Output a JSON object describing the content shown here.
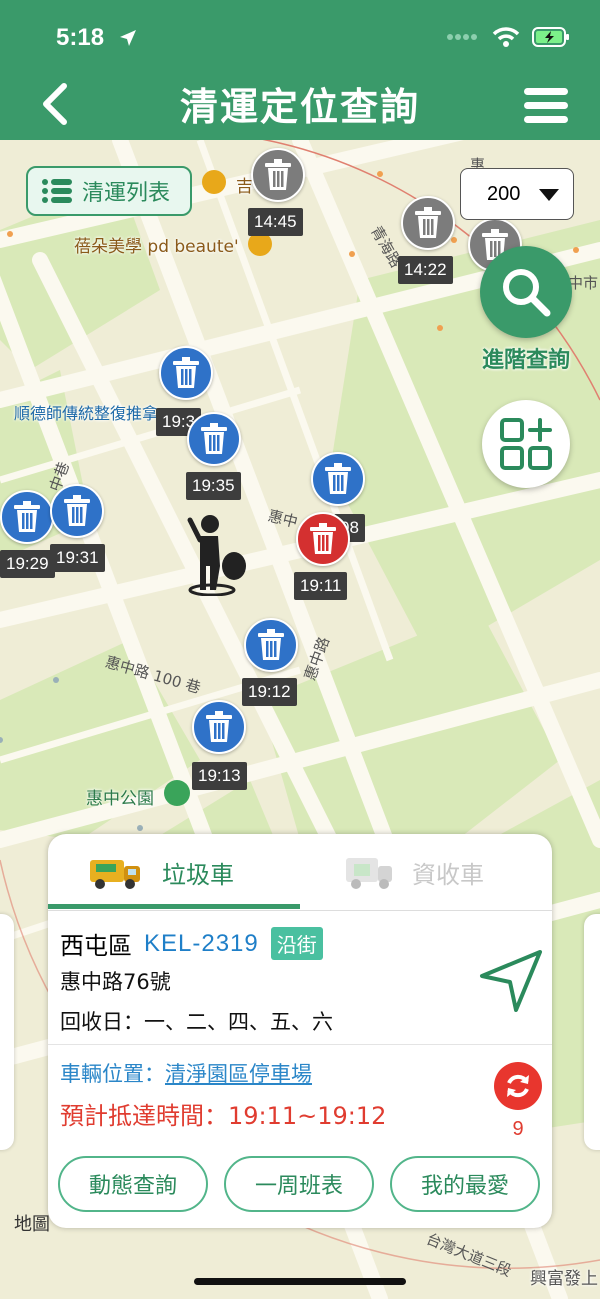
{
  "status_bar": {
    "time": "5:18"
  },
  "header": {
    "title": "清運定位查詢"
  },
  "map": {
    "list_button_label": "清運列表",
    "radius_select": {
      "value": "200"
    },
    "advanced_search_label": "進階查詢",
    "poi": {
      "ji": "吉",
      "beauty": "蓓朵美學 pd beaute'",
      "massage": "順德師傳統整復推拿",
      "park": "惠中公園",
      "rear_right": "興富發上"
    },
    "streets": {
      "road100": "惠中路 100 巷",
      "road": "惠中路",
      "hui": "惠中",
      "qinghai": "青海路",
      "zhongshi": "中市",
      "taiwan": "台灣大道三段",
      "zhong": "中巷",
      "hui_top": "惠"
    },
    "markers": [
      {
        "time": "14:45",
        "color": "gray"
      },
      {
        "time": "14:22",
        "color": "gray"
      },
      {
        "time": "19:3",
        "color": "blue"
      },
      {
        "time": "19:35",
        "color": "blue"
      },
      {
        "time": "08",
        "color": "blue"
      },
      {
        "time": "19:29",
        "color": "blue"
      },
      {
        "time": "19:31",
        "color": "blue"
      },
      {
        "time": "19:11",
        "color": "red"
      },
      {
        "time": "19:12",
        "color": "blue"
      },
      {
        "time": "19:13",
        "color": "blue"
      }
    ],
    "legal": "地圖"
  },
  "card": {
    "tabs": [
      {
        "label": "垃圾車"
      },
      {
        "label": "資收車"
      }
    ],
    "district": "西屯區",
    "plate": "KEL-2319",
    "badge": "沿街",
    "address": "惠中路76號",
    "collection_days": "回收日：一、二、四、五、六",
    "vehicle_position_label": "車輛位置：",
    "vehicle_position_value": "清淨園區停車場",
    "eta": "預計抵達時間：19:11~19:12",
    "refresh_count": "9",
    "buttons": [
      {
        "label": "動態查詢"
      },
      {
        "label": "一周班表"
      },
      {
        "label": "我的最愛"
      }
    ]
  },
  "colors": {
    "primary": "#3a9a6a",
    "blue_marker": "#2f72c8",
    "red_marker": "#d43030",
    "eta": "#e03c30"
  }
}
